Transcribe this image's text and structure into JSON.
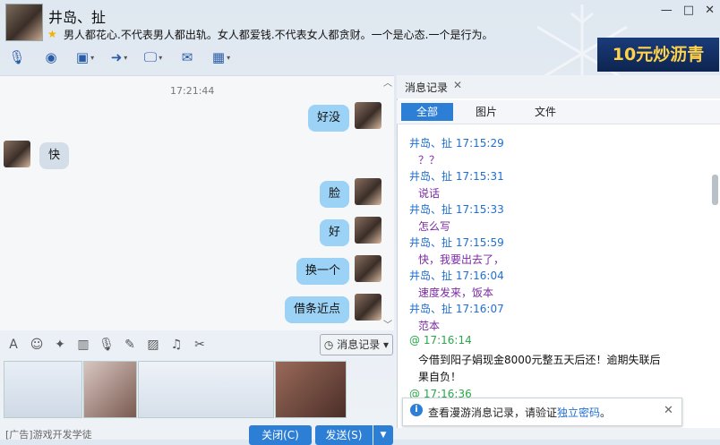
{
  "header": {
    "contact_name": "井岛、扯",
    "signature": "男人都花心.不代表男人都出轨。女人都爱钱.不代表女人都贪财。一个是心态.一个是行为。",
    "window_controls": [
      "—",
      "□",
      "✕"
    ],
    "ad_banner": "10元炒沥青"
  },
  "toolbar": {
    "icons": [
      "microphone-icon",
      "video-call-icon",
      "screen-share-icon",
      "file-transfer-icon",
      "remote-desktop-icon",
      "message-icon",
      "apps-icon"
    ]
  },
  "chat": {
    "timestamp": "17:21:44",
    "messages": [
      {
        "text": "好没",
        "side": "out"
      },
      {
        "text": "快",
        "side": "in"
      },
      {
        "text": "脸",
        "side": "out"
      },
      {
        "text": "好",
        "side": "out"
      },
      {
        "text": "换一个",
        "side": "out"
      },
      {
        "text": "借条近点",
        "side": "out"
      }
    ]
  },
  "input_toolbar": {
    "history_button": "消息记录"
  },
  "bottom": {
    "ad_text": "[广告]游戏开发学徒",
    "close_button": "关闭(C)",
    "send_button": "发送(S)"
  },
  "history_panel": {
    "title": "消息记录",
    "tabs": [
      "全部",
      "图片",
      "文件"
    ],
    "entries": [
      {
        "sender": "井岛、扯 17:15:29",
        "text": "？？"
      },
      {
        "sender": "井岛、扯 17:15:31",
        "text": "说话"
      },
      {
        "sender": "井岛、扯 17:15:33",
        "text": "怎么写"
      },
      {
        "sender": "井岛、扯 17:15:59",
        "text": "快，我要出去了，"
      },
      {
        "sender": "井岛、扯 17:16:04",
        "text": "速度发来，饭本"
      },
      {
        "sender": "井岛、扯 17:16:07",
        "text": "范本"
      }
    ],
    "self_entry": {
      "sender": "@ 17:16:14",
      "text_line1": "今借到阳子娟现金8000元整五天后还！逾期失联后",
      "text_line2": "果自负！"
    },
    "next_sender": "@ 17:16:36",
    "notice_text": "查看漫游消息记录，请验证",
    "notice_link": "独立密码",
    "notice_end": "。"
  },
  "colors": {
    "accent": "#2d7fd6",
    "outgoing_bubble": "#9bd2f5",
    "incoming_bubble": "#d4dee8",
    "sender_blue": "#1f6fd4",
    "msg_purple": "#7a2aa0"
  }
}
